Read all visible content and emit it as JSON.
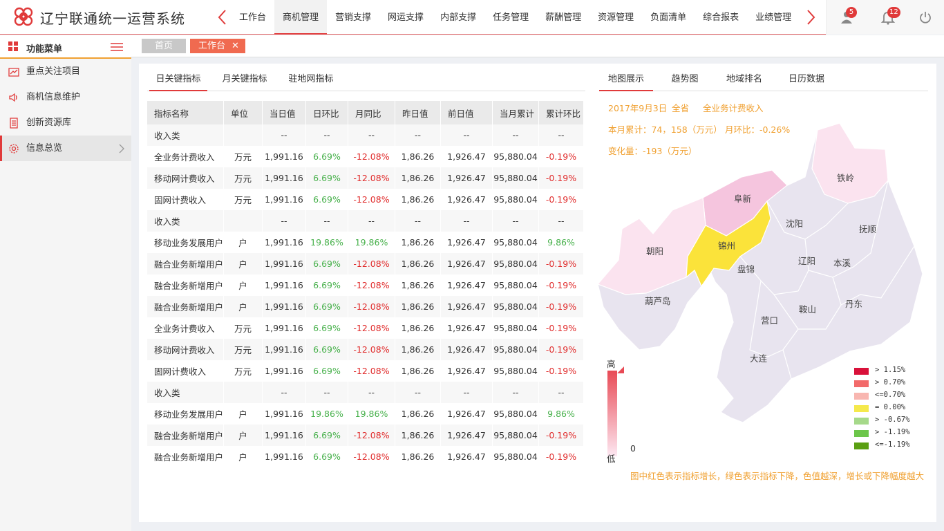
{
  "header": {
    "app_title": "辽宁联通统一运营系统",
    "nav": [
      "工作台",
      "商机管理",
      "营销支撑",
      "网运支撑",
      "内部支撑",
      "任务管理",
      "薪酬管理",
      "资源管理",
      "负面清单",
      "综合报表",
      "业绩管理"
    ],
    "active_nav": "商机管理",
    "notifications": {
      "user_badge": "5",
      "bell_badge": "12"
    },
    "icons": [
      "left-arrow-icon",
      "right-arrow-icon",
      "user-icon",
      "bell-icon",
      "power-icon"
    ]
  },
  "sidebar": {
    "title": "功能菜单",
    "items": [
      {
        "label": "重点关注项目",
        "icon": "chart-icon"
      },
      {
        "label": "商机信息维护",
        "icon": "speaker-icon"
      },
      {
        "label": "创新资源库",
        "icon": "document-icon"
      },
      {
        "label": "信息总览",
        "icon": "gear-icon",
        "active": true
      }
    ]
  },
  "page_tabs": {
    "home": "首页",
    "current": "工作台",
    "close": "✕"
  },
  "left_tabs": [
    "日关键指标",
    "月关键指标",
    "驻地网指标"
  ],
  "table": {
    "headers": [
      "指标名称",
      "单位",
      "当日值",
      "日环比",
      "月同比",
      "昨日值",
      "前日值",
      "当月累计",
      "累计环比"
    ],
    "rows": [
      [
        "收入类",
        "",
        "--",
        "--",
        "--",
        "--",
        "--",
        "--",
        "--"
      ],
      [
        "全业务计费收入",
        "万元",
        "1,991.16",
        "6.69%",
        "-12.08%",
        "1,86.26",
        "1,926.47",
        "95,880.04",
        "-0.19%"
      ],
      [
        "移动网计费收入",
        "万元",
        "1,991.16",
        "6.69%",
        "-12.08%",
        "1,86.26",
        "1,926.47",
        "95,880.04",
        "-0.19%"
      ],
      [
        "固网计费收入",
        "万元",
        "1,991.16",
        "6.69%",
        "-12.08%",
        "1,86.26",
        "1,926.47",
        "95,880.04",
        "-0.19%"
      ],
      [
        "收入类",
        "",
        "--",
        "--",
        "--",
        "--",
        "--",
        "--",
        "--"
      ],
      [
        "移动业务发展用户",
        "户",
        "1,991.16",
        "19.86%",
        "19.86%",
        "1,86.26",
        "1,926.47",
        "95,880.04",
        "9.86%"
      ],
      [
        "融合业务新增用户",
        "户",
        "1,991.16",
        "6.69%",
        "-12.08%",
        "1,86.26",
        "1,926.47",
        "95,880.04",
        "-0.19%"
      ],
      [
        "融合业务新增用户",
        "户",
        "1,991.16",
        "6.69%",
        "-12.08%",
        "1,86.26",
        "1,926.47",
        "95,880.04",
        "-0.19%"
      ],
      [
        "融合业务新增用户",
        "户",
        "1,991.16",
        "6.69%",
        "-12.08%",
        "1,86.26",
        "1,926.47",
        "95,880.04",
        "-0.19%"
      ],
      [
        "全业务计费收入",
        "万元",
        "1,991.16",
        "6.69%",
        "-12.08%",
        "1,86.26",
        "1,926.47",
        "95,880.04",
        "-0.19%"
      ],
      [
        "移动网计费收入",
        "万元",
        "1,991.16",
        "6.69%",
        "-12.08%",
        "1,86.26",
        "1,926.47",
        "95,880.04",
        "-0.19%"
      ],
      [
        "固网计费收入",
        "万元",
        "1,991.16",
        "6.69%",
        "-12.08%",
        "1,86.26",
        "1,926.47",
        "95,880.04",
        "-0.19%"
      ],
      [
        "收入类",
        "",
        "--",
        "--",
        "--",
        "--",
        "--",
        "--",
        "--"
      ],
      [
        "移动业务发展用户",
        "户",
        "1,991.16",
        "19.86%",
        "19.86%",
        "1,86.26",
        "1,926.47",
        "95,880.04",
        "9.86%"
      ],
      [
        "融合业务新增用户",
        "户",
        "1,991.16",
        "6.69%",
        "-12.08%",
        "1,86.26",
        "1,926.47",
        "95,880.04",
        "-0.19%"
      ],
      [
        "融合业务新增用户",
        "户",
        "1,991.16",
        "6.69%",
        "-12.08%",
        "1,86.26",
        "1,926.47",
        "95,880.04",
        "-0.19%"
      ]
    ]
  },
  "right_tabs": [
    "地图展示",
    "趋势图",
    "地域排名",
    "日历数据"
  ],
  "map": {
    "date": "2017年9月3日",
    "scope": "全省",
    "metric": "全业务计费收入",
    "month_total": "本月累计：74，158（万元）",
    "month_ratio": "月环比：-0.26%",
    "change": "变化量：-193（万元）",
    "cities": [
      "铁岭",
      "阜新",
      "沈阳",
      "抚顺",
      "朝阳",
      "锦州",
      "盘锦",
      "辽阳",
      "本溪",
      "葫芦岛",
      "鞍山",
      "丹东",
      "营口",
      "大连"
    ],
    "gradient_high": "高",
    "gradient_low": "低",
    "gradient_zero": "0",
    "legend": [
      {
        "label": "> 1.15%",
        "color": "#d9113a"
      },
      {
        "label": "> 0.70%",
        "color": "#f26a6a"
      },
      {
        "label": "<=0.70%",
        "color": "#f8b6b0"
      },
      {
        "label": "= 0.00%",
        "color": "#f5e94c"
      },
      {
        "label": "> -0.67%",
        "color": "#a6d98a"
      },
      {
        "label": "> -1.19%",
        "color": "#6cc64a"
      },
      {
        "label": "<=-1.19%",
        "color": "#5a9f12"
      }
    ],
    "note": "图中红色表示指标增长，绿色表示指标下降，色值越深，增长或下降幅度越大",
    "colors": {
      "fill_default": "#e8e4ef",
      "pink_light": "#fbe3ef",
      "pink_mid": "#f5c5de",
      "yellow": "#fbe33a"
    }
  },
  "colors": {
    "accent": "#e03a3a",
    "orange": "#f0a030",
    "up": "#46b04a",
    "down": "#e02a2a"
  }
}
